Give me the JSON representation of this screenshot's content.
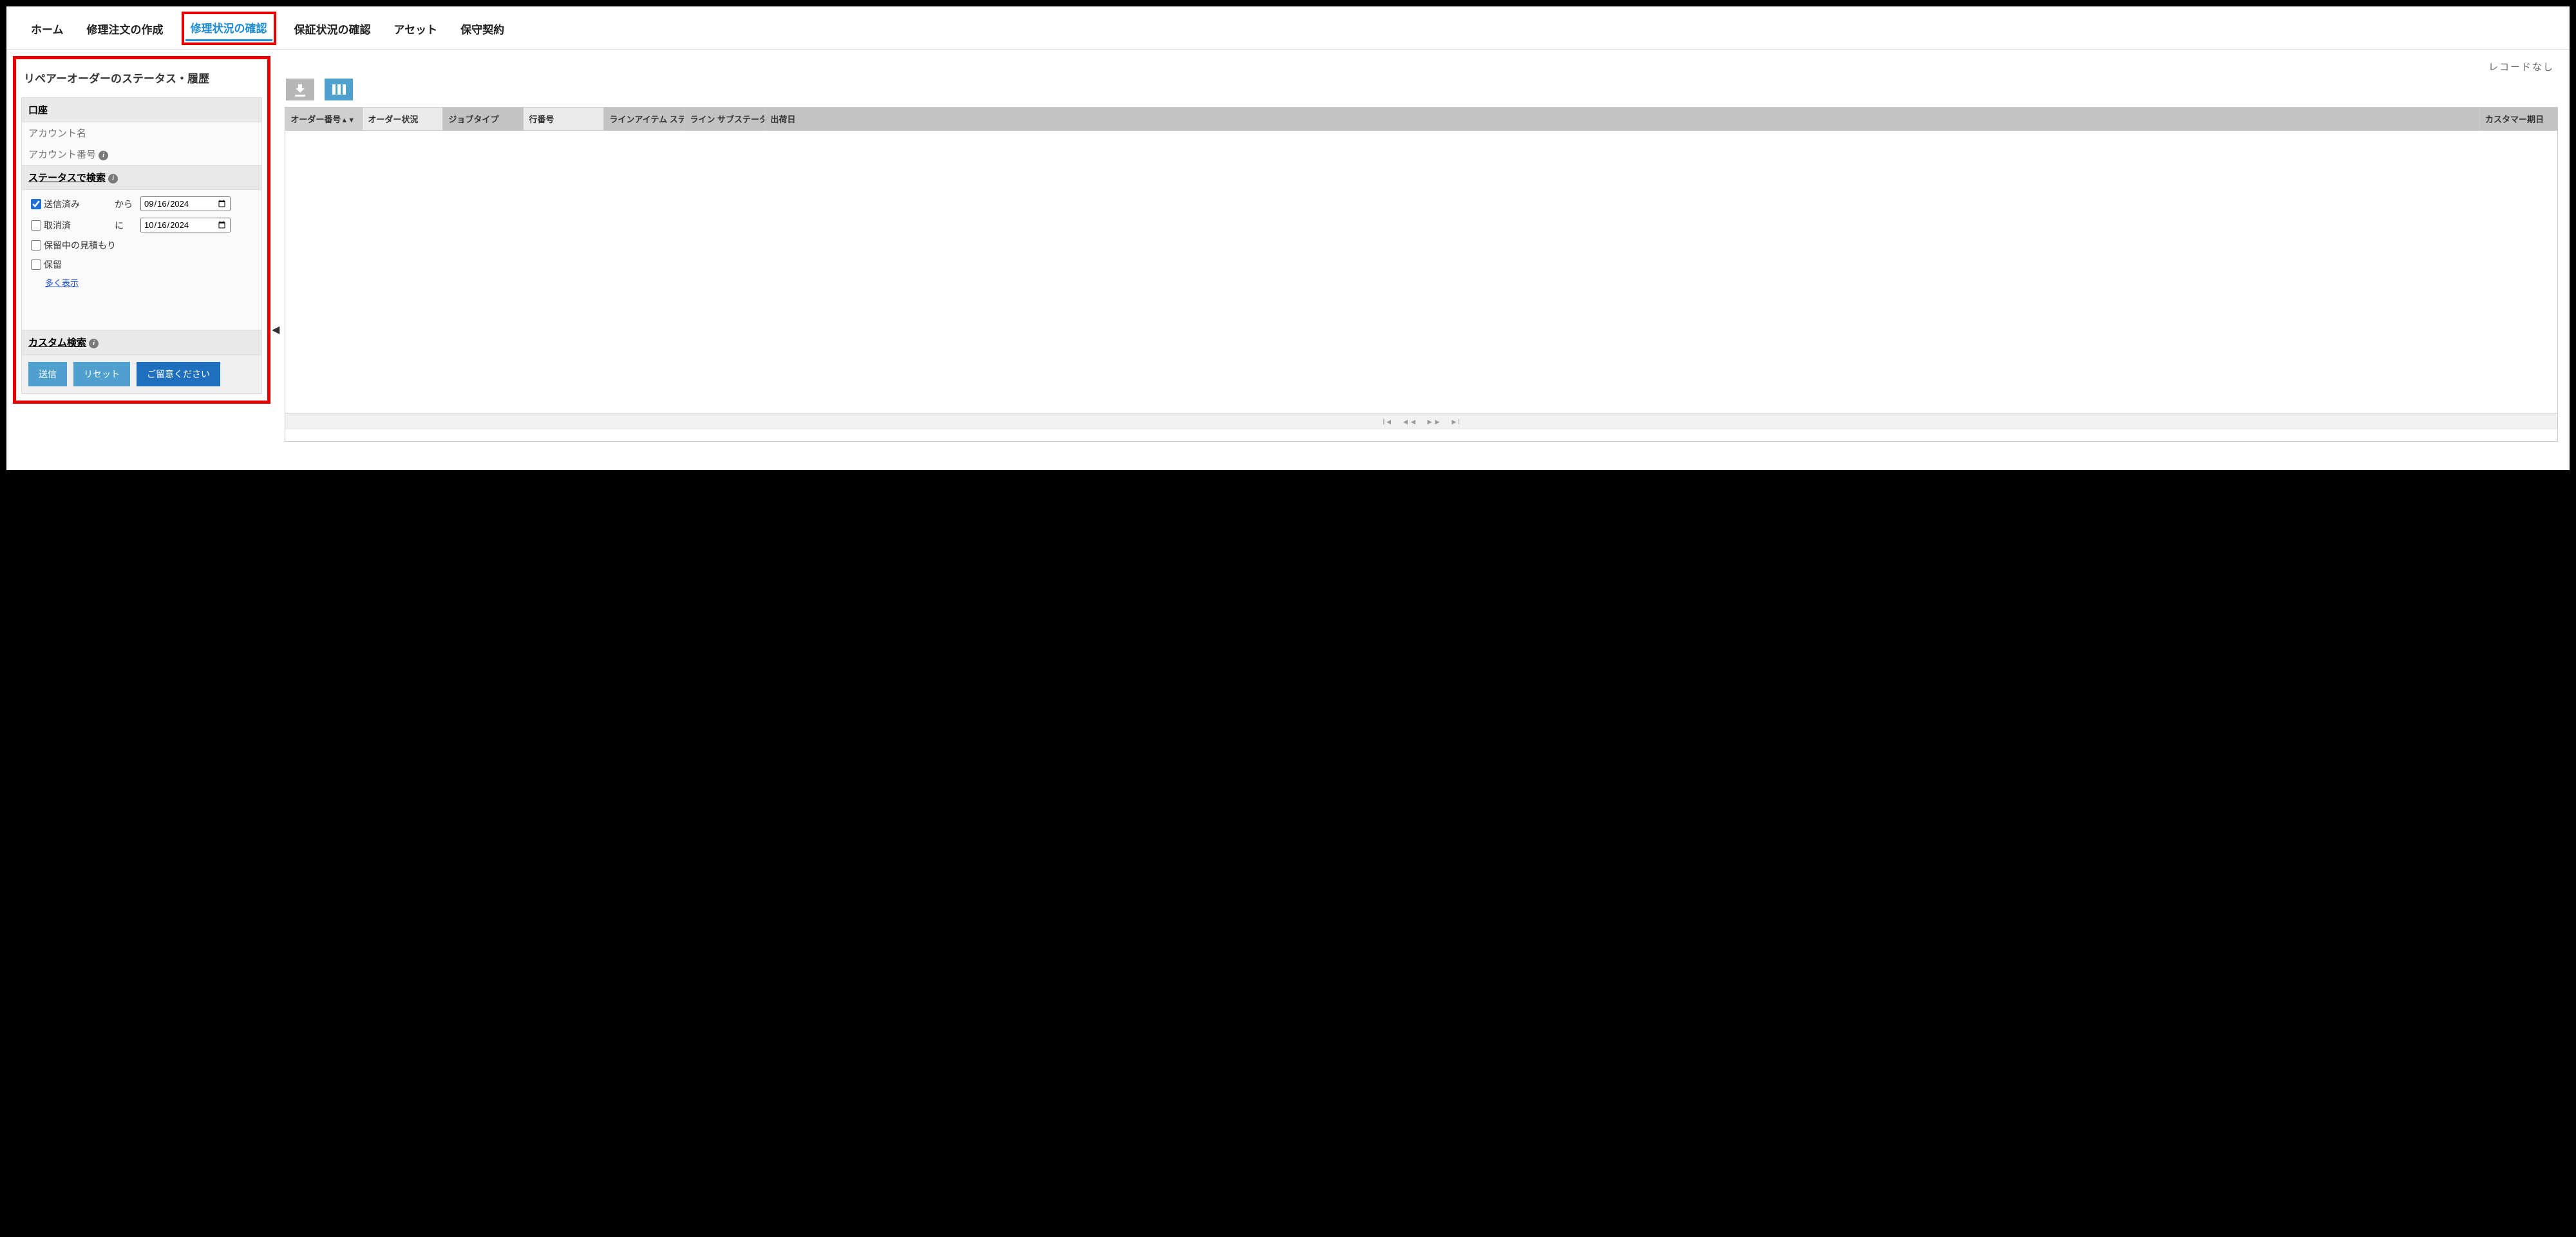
{
  "nav": {
    "home": "ホーム",
    "create_repair_order": "修理注文の作成",
    "repair_status": "修理状況の確認",
    "warranty_status": "保証状況の確認",
    "asset": "アセット",
    "maintenance_contract": "保守契約"
  },
  "sidebar": {
    "title": "リペアーオーダーのステータス・履歴",
    "account_header": "口座",
    "account_name_label": "アカウント名",
    "account_number_label": "アカウント番号",
    "status_search_header": "ステータスで検索",
    "statuses": {
      "submitted": "送信済み",
      "cancelled": "取消済",
      "pending_quote": "保留中の見積もり",
      "on_hold": "保留"
    },
    "from_label": "から",
    "to_label": "に",
    "from_date": "2024-09-16",
    "to_date": "2024-10-16",
    "show_more": "多く表示",
    "custom_search_header": "カスタム検索",
    "buttons": {
      "submit": "送信",
      "reset": "リセット",
      "notice": "ご留意ください"
    }
  },
  "main": {
    "no_records": "レコードなし",
    "columns": {
      "order_number": "オーダー番号",
      "order_status": "オーダー状況",
      "job_type": "ジョブタイプ",
      "line_number": "行番号",
      "line_item_status": "ラインアイテム ステ",
      "line_substatus": "ライン サブステータ",
      "ship_date": "出荷日",
      "customer_due_date": "カスタマー期日"
    },
    "sort_arrows": "▲▼"
  }
}
